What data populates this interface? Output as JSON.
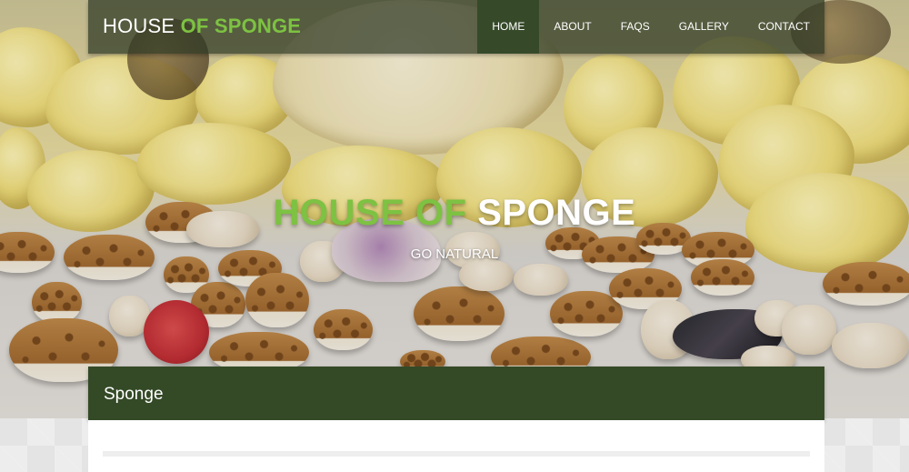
{
  "navbar": {
    "brand_part1": "HOUSE ",
    "brand_part2": "OF SPONGE",
    "items": [
      {
        "label": "HOME",
        "active": true
      },
      {
        "label": "ABOUT",
        "active": false
      },
      {
        "label": "FAQS",
        "active": false
      },
      {
        "label": "GALLERY",
        "active": false
      },
      {
        "label": "CONTACT",
        "active": false
      }
    ]
  },
  "hero": {
    "title_part1": "HOUSE OF ",
    "title_part2": "SPONGE",
    "subtitle": "GO NATURAL"
  },
  "section": {
    "title": "Sponge"
  },
  "colors": {
    "accent_green": "#7dc242",
    "header_green": "#344a27",
    "nav_active": "#364a2a"
  }
}
